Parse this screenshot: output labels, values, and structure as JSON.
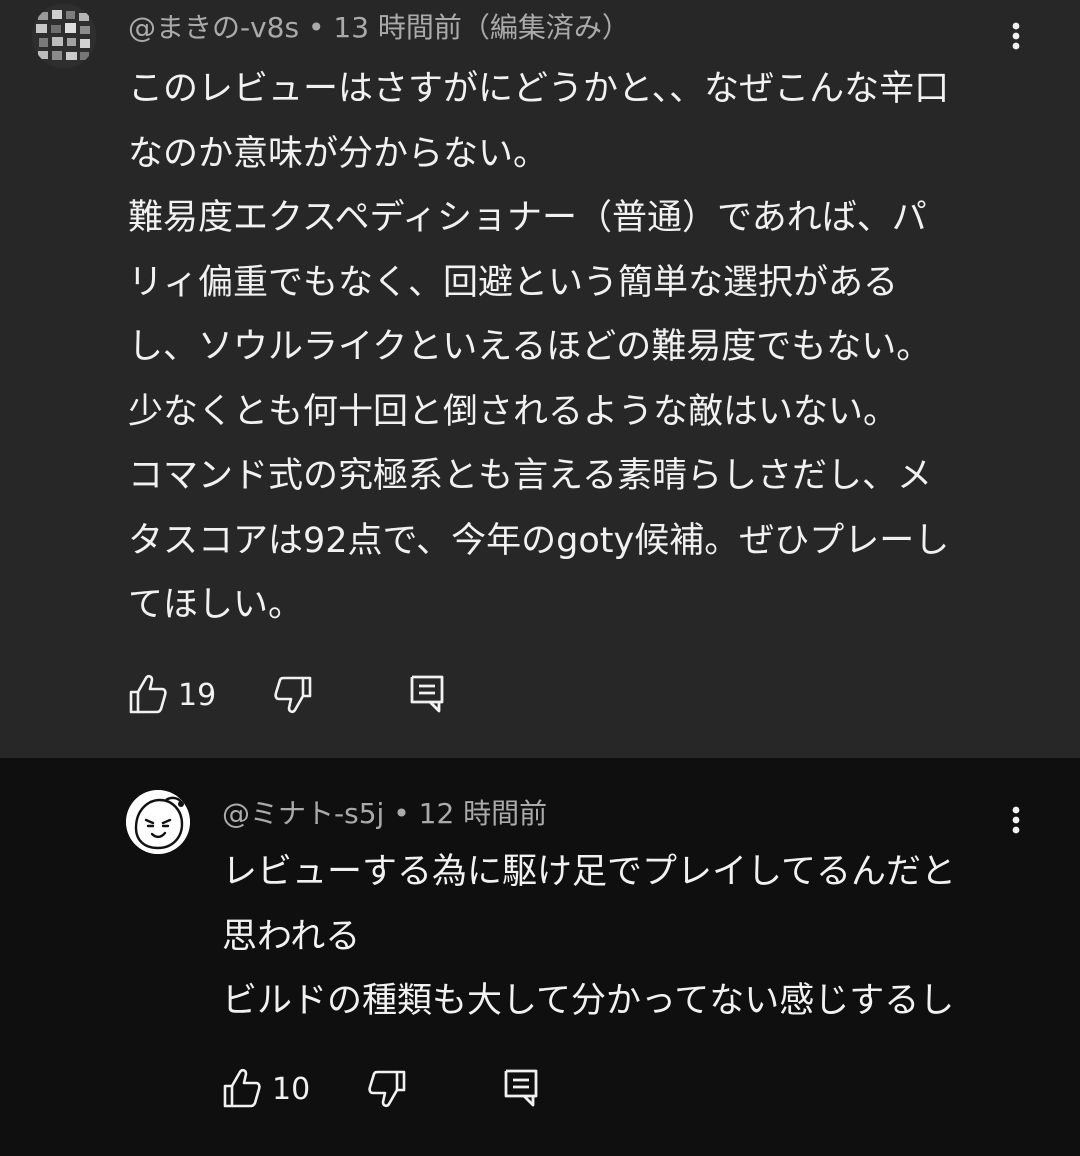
{
  "comments": [
    {
      "author": "@まきの-v8s",
      "separator": "•",
      "time": "13 時間前（編集済み）",
      "lines": [
        "このレビューはさすがにどうかと、、なぜこんな辛口",
        "なのか意味が分からない。",
        "難易度エクスペディショナー（普通）であれば、パ",
        "リィ偏重でもなく、回避という簡単な選択がある",
        "し、ソウルライクといえるほどの難易度でもない。",
        "少なくとも何十回と倒されるような敵はいない。",
        "コマンド式の究極系とも言える素晴らしさだし、メ",
        "タスコアは92点で、今年のgoty候補。ぜひプレーし",
        "てほしい。"
      ],
      "likes": "19",
      "avatar_icon": "pixel-pattern-avatar-icon"
    },
    {
      "author": "@ミナト-s5j",
      "separator": "•",
      "time": "12 時間前",
      "lines": [
        "レビューする為に駆け足でプレイしてるんだと",
        "思われる",
        "ビルドの種類も大して分かってない感じするし"
      ],
      "likes": "10",
      "avatar_icon": "smirk-face-avatar-icon"
    }
  ],
  "colors": {
    "background": "#0f0f0f",
    "highlighted_background": "#272727",
    "text": "#f1f1f1",
    "secondary_text": "#aaaaaa"
  },
  "icons": {
    "like": "thumbs-up-icon",
    "dislike": "thumbs-down-icon",
    "reply": "reply-icon",
    "menu": "more-vertical-icon"
  }
}
